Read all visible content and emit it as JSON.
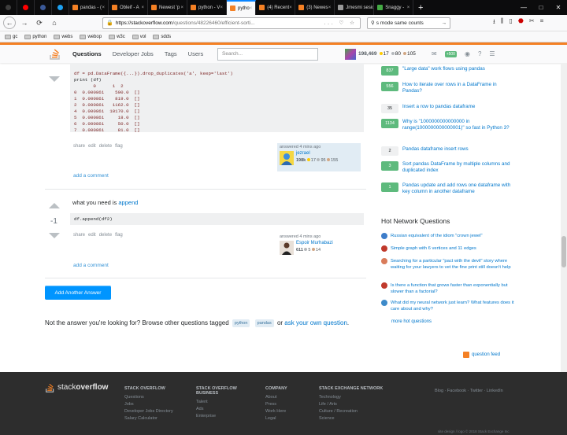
{
  "browser": {
    "tabs": [
      {
        "label": "",
        "kind": "pinned",
        "color": "#3d3d3d"
      },
      {
        "label": "",
        "kind": "pinned",
        "color": "#ff0000"
      },
      {
        "label": "",
        "kind": "pinned",
        "color": "#3b5998"
      },
      {
        "label": "",
        "kind": "pinned",
        "color": "#1da1f2"
      },
      {
        "label": "pandas - (",
        "kind": "normal",
        "color": "#f48024"
      },
      {
        "label": "Obleif - A",
        "kind": "normal",
        "color": "#f48024"
      },
      {
        "label": "Newest 'p",
        "kind": "normal",
        "color": "#f48024"
      },
      {
        "label": "python - V",
        "kind": "normal",
        "color": "#f48024"
      },
      {
        "label": "pytho",
        "kind": "active",
        "color": "#f48024"
      },
      {
        "label": "(4) Recent",
        "kind": "normal",
        "color": "#f48024"
      },
      {
        "label": "(3) Newes",
        "kind": "normal",
        "color": "#f48024"
      },
      {
        "label": "Jmesmi sesion",
        "kind": "normal",
        "color": "#999999"
      },
      {
        "label": "Snaggy - ",
        "kind": "normal",
        "color": "#44aa44"
      }
    ],
    "url_host": "https://stackoverflow.com",
    "url_path": "/questions/48226460/efficient-sorti...",
    "url_tools": "... ♡ ☆",
    "search_value": "s mode same counts",
    "bookmarks": [
      "gc",
      "python",
      "webs",
      "webop",
      "w3c",
      "vol",
      "sdds"
    ]
  },
  "so": {
    "nav": [
      "Questions",
      "Developer Jobs",
      "Tags",
      "Users"
    ],
    "search_placeholder": "Search...",
    "rep": "198,469",
    "gold": "17",
    "silver": "80",
    "bronze": "105",
    "achievement": "+500"
  },
  "answer1": {
    "code_line0": "df = pd.DataFrame({...}).drop_duplicates('a', keep='last')",
    "code_line1": "print (df)",
    "code_header": "       0      1  2",
    "rows": [
      "0  0.000861    500.0  []",
      "1  0.000861    819.0  []",
      "2  0.000861   1162.0  []",
      "4  0.000861  10170.0  []",
      "5  0.000861     18.0  []",
      "6  0.000861     50.0  []",
      "7  0.000861     81.0  []"
    ],
    "menu": [
      "share",
      "edit",
      "delete",
      "flag"
    ],
    "answered": "answered 4 mins ago",
    "user": "jezrael",
    "user_rep": "198k",
    "user_gold": "17",
    "user_silver": "95",
    "user_bronze": "155",
    "add_comment": "add a comment"
  },
  "answer2": {
    "votes": "-1",
    "text_prefix": "what you need is",
    "link": "append",
    "code": "df.append(df2)",
    "menu": [
      "share",
      "edit",
      "delete",
      "flag"
    ],
    "answered": "answered 4 mins ago",
    "user": "Espoir Murhabazi",
    "user_rep": "611",
    "user_silver": "5",
    "user_bronze": "14",
    "add_comment": "add a comment"
  },
  "add_answer_button": "Add Another Answer",
  "not_answer": {
    "prefix": "Not the answer you're looking for? Browse other questions tagged",
    "tags": [
      "python",
      "pandas"
    ],
    "or": "or",
    "ask_link": "ask your own question",
    "suffix": "."
  },
  "related": [
    {
      "count": "837",
      "text": "\"Large data\" work flows using pandas",
      "answered": true
    },
    {
      "count": "556",
      "text": "How to iterate over rows in a DataFrame in Pandas?",
      "answered": true
    },
    {
      "count": "35",
      "text": "Insert a row to pandas dataframe",
      "answered": false
    },
    {
      "count": "1134",
      "text": "Why is \"1000000000000000 in range(1000000000000001)\" so fast in Python 3?",
      "answered": true
    },
    {
      "count": "2",
      "text": "Pandas dataframe insert rows",
      "answered": false
    },
    {
      "count": "3",
      "text": "Sort pandas DataFrame by multiple columns and duplicated index",
      "answered": true
    },
    {
      "count": "1",
      "text": "Pandas update and add rows one dataframe with key column in another dataframe",
      "answered": true
    }
  ],
  "hot": {
    "title": "Hot Network Questions",
    "items": [
      {
        "text": "Russian equivalent of the idiom \"crown jewel\"",
        "color": "#3d7cc9"
      },
      {
        "text": "Simple graph with 6 vertices and 11 edges",
        "color": "#c0392b"
      },
      {
        "text": "Searching for a particular \"pact with the devil\" story where waiting for your lawyers to vet the fine print still doesn't help",
        "color": "#d97b5a"
      },
      {
        "text": "Is there a function that grows faster than exponentially but slower than a factorial?",
        "color": "#c0392b"
      },
      {
        "text": "What did my neural network just learn? What features does it care about and why?",
        "color": "#3d8ac9"
      }
    ],
    "more": "more hot questions"
  },
  "question_feed": "question feed",
  "footer": {
    "logo_a": "stack",
    "logo_b": "overflow",
    "cols": [
      {
        "head": "Stack Overflow",
        "items": [
          "Questions",
          "Jobs",
          "Developer Jobs Directory",
          "Salary Calculator"
        ]
      },
      {
        "head": "Stack Overflow Business",
        "items": [
          "Talent",
          "Ads",
          "Enterprise"
        ]
      },
      {
        "head": "Company",
        "items": [
          "About",
          "Press",
          "Work Here",
          "Legal"
        ]
      },
      {
        "head": "Stack Exchange Network",
        "items": [
          "Technology",
          "Life / Arts",
          "Culture / Recreation",
          "Science"
        ]
      }
    ],
    "social": "Blog · Facebook · Twitter · LinkedIn",
    "copyright": "site design / logo © 2018 Stack Exchange Inc"
  }
}
